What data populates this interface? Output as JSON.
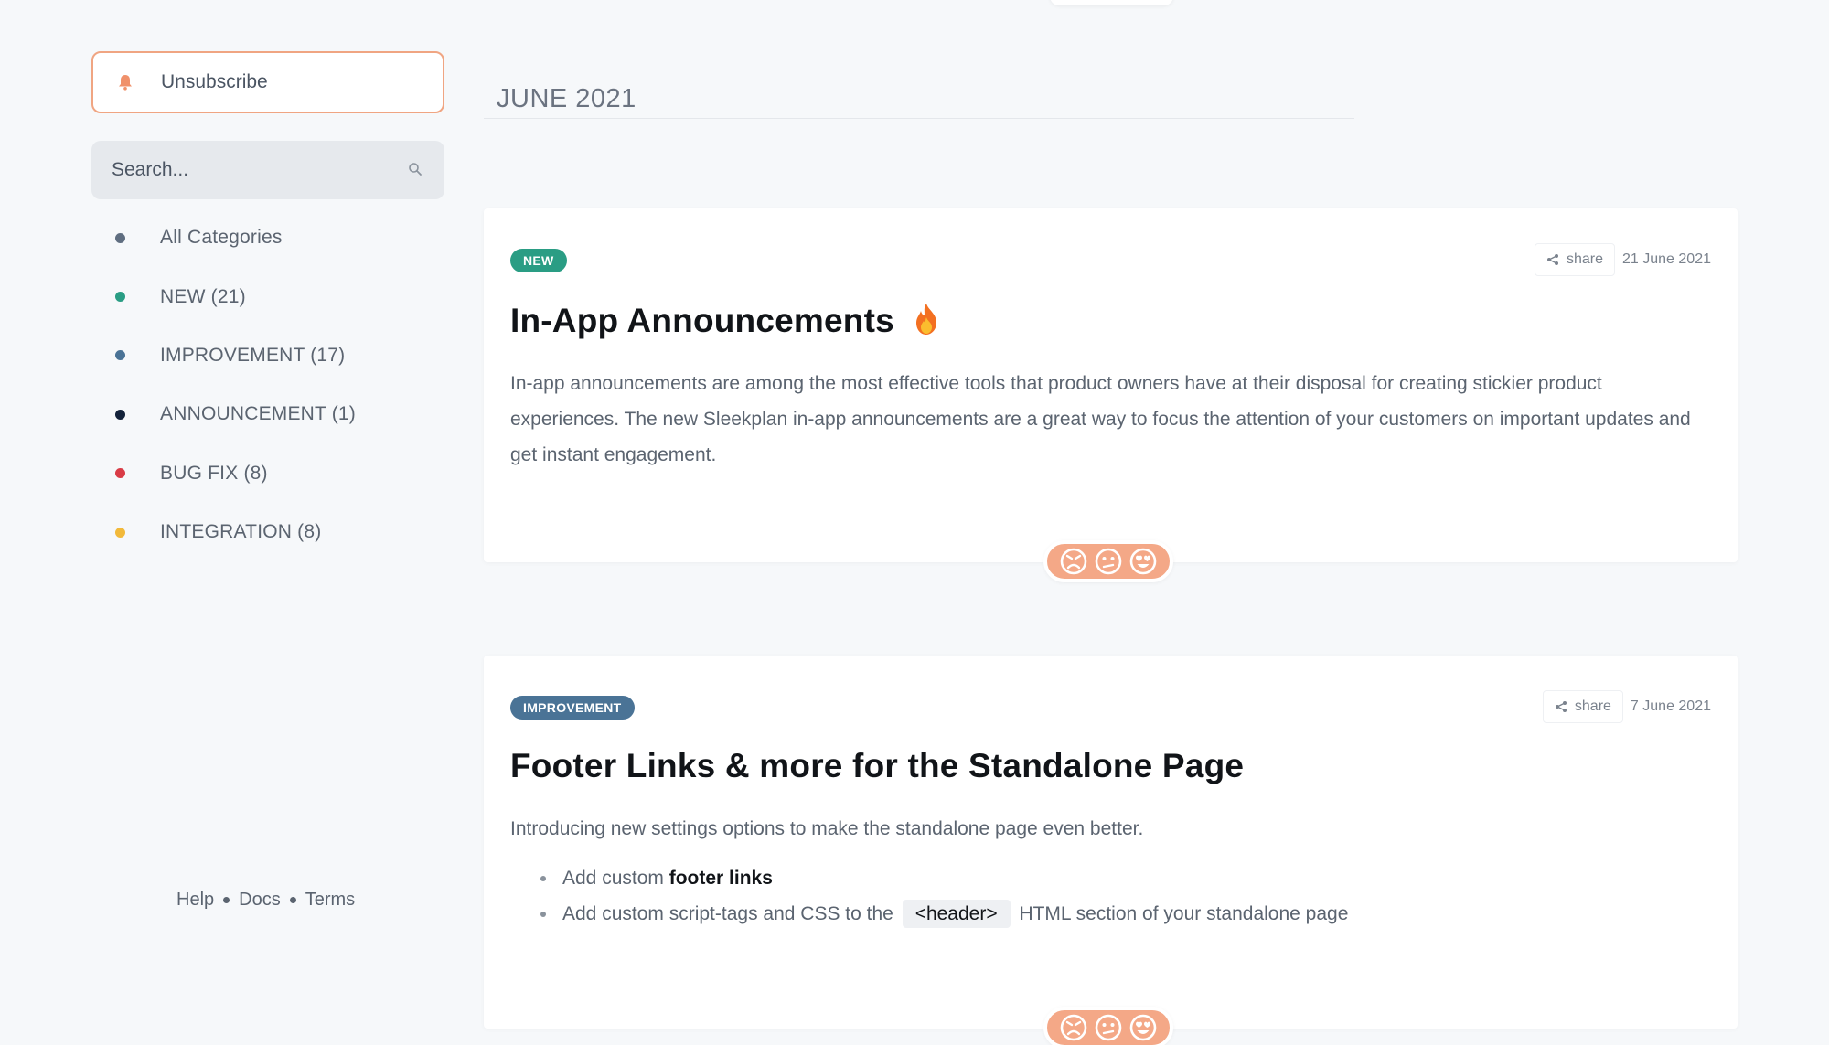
{
  "sidebar": {
    "unsubscribe_label": "Unsubscribe",
    "search_placeholder": "Search...",
    "categories": [
      {
        "label": "All Categories",
        "color": "#5f6e80"
      },
      {
        "label": "NEW (21)",
        "color": "#2a9d84"
      },
      {
        "label": "IMPROVEMENT (17)",
        "color": "#4a7396"
      },
      {
        "label": "ANNOUNCEMENT (1)",
        "color": "#13223a"
      },
      {
        "label": "BUG FIX (8)",
        "color": "#d93c46"
      },
      {
        "label": "INTEGRATION (8)",
        "color": "#f2b93a"
      }
    ],
    "footer": {
      "help": "Help",
      "docs": "Docs",
      "terms": "Terms"
    }
  },
  "main": {
    "month": "JUNE 2021",
    "posts": [
      {
        "badge": "NEW",
        "badge_color": "#2a9d84",
        "share_label": "share",
        "date": "21 June 2021",
        "title": "In-App Announcements",
        "title_icon": "fire-icon",
        "body": "In-app announcements are among the most effective tools that product owners have at their disposal for creating stickier product experiences. The new Sleekplan in-app announcements are a great way to focus the attention of your customers on important updates and get instant engagement."
      },
      {
        "badge": "IMPROVEMENT",
        "badge_color": "#4a7396",
        "share_label": "share",
        "date": "7 June 2021",
        "title": "Footer Links & more for the Standalone Page",
        "body": "Introducing new settings options to make the standalone page even better.",
        "bullets": [
          {
            "pre": "Add custom ",
            "bold": "footer links"
          },
          {
            "pre": "Add custom script-tags and CSS to the ",
            "code": "<header>",
            "post": " HTML section of your standalone page"
          }
        ]
      }
    ],
    "reaction_icons": [
      "angry-face-icon",
      "confused-face-icon",
      "heart-eyes-face-icon"
    ],
    "reaction_color": "#f4a887"
  },
  "colors": {
    "accent": "#f0a582",
    "background": "#f6f8fa"
  }
}
